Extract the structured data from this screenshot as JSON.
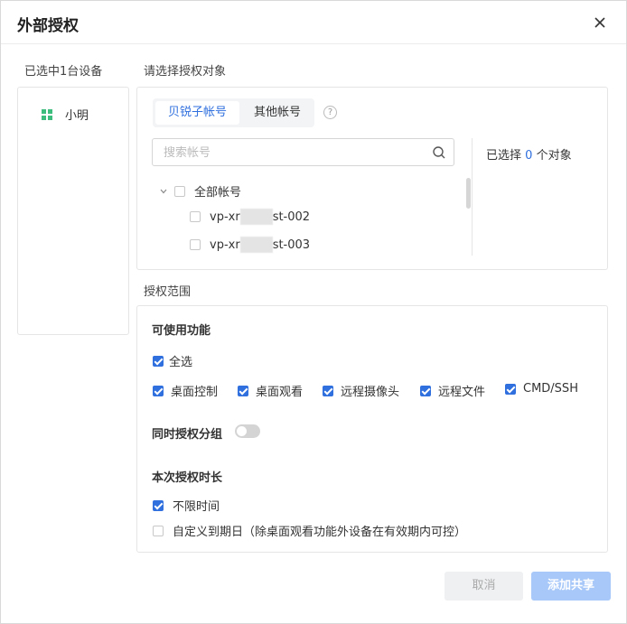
{
  "dialog": {
    "title": "外部授权"
  },
  "left": {
    "label": "已选中1台设备",
    "device_name": "小明"
  },
  "target": {
    "label": "请选择授权对象",
    "tabs": [
      "贝锐子帐号",
      "其他帐号"
    ],
    "help": "?",
    "search_placeholder": "搜索帐号",
    "tree": {
      "root": "全部帐号",
      "children": [
        {
          "prefix": "vp-xr",
          "suffix": "st-002"
        },
        {
          "prefix": "vp-xr",
          "suffix": "st-003"
        }
      ]
    },
    "selected_prefix": "已选择",
    "selected_count": "0",
    "selected_suffix": "个对象"
  },
  "scope": {
    "label": "授权范围",
    "features_title": "可使用功能",
    "select_all": "全选",
    "features": [
      "桌面控制",
      "桌面观看",
      "远程摄像头",
      "远程文件",
      "CMD/SSH"
    ],
    "group_title": "同时授权分组",
    "group_enabled": false,
    "duration_title": "本次授权时长",
    "unlimited": "不限时间",
    "custom": "自定义到期日（除桌面观看功能外设备在有效期内可控）"
  },
  "footer": {
    "cancel": "取消",
    "confirm": "添加共享"
  },
  "colors": {
    "accent": "#2f6fde",
    "device_icon": "#3dbd7d",
    "confirm_bg": "#a7c8f8"
  }
}
